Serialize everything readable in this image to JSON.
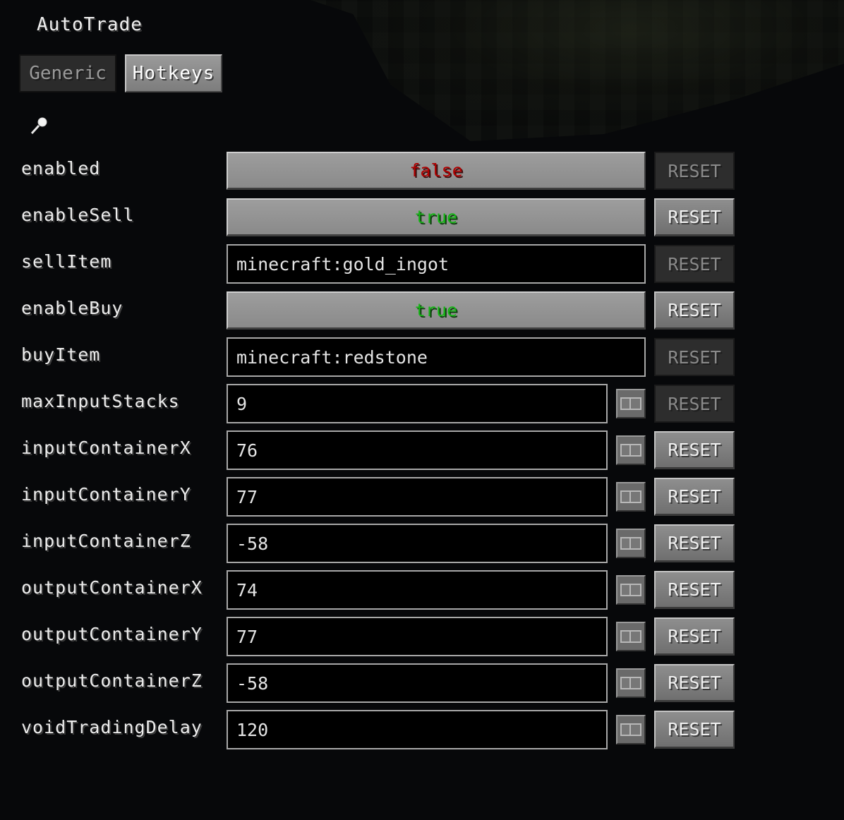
{
  "window": {
    "title": "AutoTrade"
  },
  "tabs": [
    {
      "label": "Generic",
      "selected": false
    },
    {
      "label": "Hotkeys",
      "selected": true
    }
  ],
  "search": {
    "icon": "search-icon"
  },
  "colors": {
    "false_value": "#b00000",
    "true_value": "#16b416",
    "background": "#07080a"
  },
  "reset_label": "RESET",
  "settings": [
    {
      "key": "enabled",
      "label": "enabled",
      "type": "toggle",
      "value": "false",
      "reset_enabled": false
    },
    {
      "key": "enableSell",
      "label": "enableSell",
      "type": "toggle",
      "value": "true",
      "reset_enabled": true
    },
    {
      "key": "sellItem",
      "label": "sellItem",
      "type": "string",
      "value": "minecraft:gold_ingot",
      "reset_enabled": false
    },
    {
      "key": "enableBuy",
      "label": "enableBuy",
      "type": "toggle",
      "value": "true",
      "reset_enabled": true
    },
    {
      "key": "buyItem",
      "label": "buyItem",
      "type": "string",
      "value": "minecraft:redstone",
      "reset_enabled": false
    },
    {
      "key": "maxInputStacks",
      "label": "maxInputStacks",
      "type": "integer",
      "value": "9",
      "reset_enabled": false
    },
    {
      "key": "inputContainerX",
      "label": "inputContainerX",
      "type": "integer",
      "value": "76",
      "reset_enabled": true
    },
    {
      "key": "inputContainerY",
      "label": "inputContainerY",
      "type": "integer",
      "value": "77",
      "reset_enabled": true
    },
    {
      "key": "inputContainerZ",
      "label": "inputContainerZ",
      "type": "integer",
      "value": "-58",
      "reset_enabled": true
    },
    {
      "key": "outputContainerX",
      "label": "outputContainerX",
      "type": "integer",
      "value": "74",
      "reset_enabled": true
    },
    {
      "key": "outputContainerY",
      "label": "outputContainerY",
      "type": "integer",
      "value": "77",
      "reset_enabled": true
    },
    {
      "key": "outputContainerZ",
      "label": "outputContainerZ",
      "type": "integer",
      "value": "-58",
      "reset_enabled": true
    },
    {
      "key": "voidTradingDelay",
      "label": "voidTradingDelay",
      "type": "integer",
      "value": "120",
      "reset_enabled": true
    }
  ]
}
